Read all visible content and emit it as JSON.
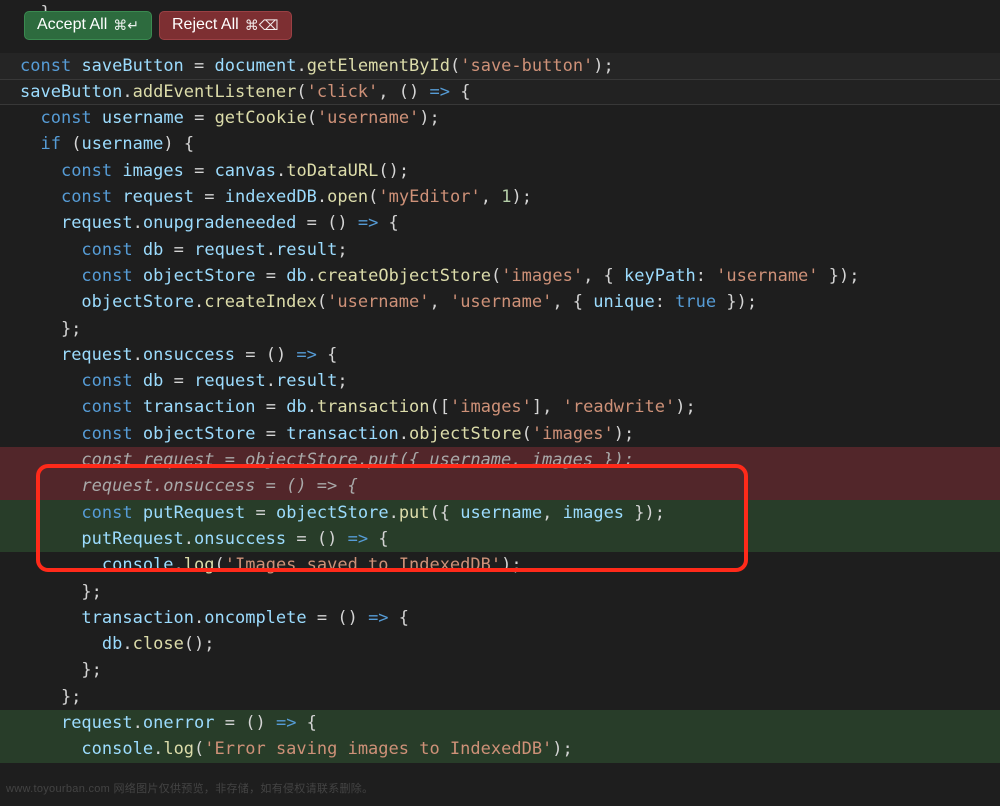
{
  "toolbar": {
    "accept_label": "Accept All",
    "accept_shortcut": "⌘↵",
    "reject_label": "Reject All",
    "reject_shortcut": "⌘⌫"
  },
  "watermark": "www.toyourban.com  网络图片仅供预览，非存储，如有侵权请联系删除。",
  "code": {
    "l1": "  }",
    "l2": "",
    "l3": "const saveButton = document.getElementById('save-button');",
    "l4": "saveButton.addEventListener('click', () => {",
    "l5": "  const username = getCookie('username');",
    "l6": "  if (username) {",
    "l7": "    const images = canvas.toDataURL();",
    "l8": "    const request = indexedDB.open('myEditor', 1);",
    "l9": "    request.onupgradeneeded = () => {",
    "l10": "      const db = request.result;",
    "l11": "      const objectStore = db.createObjectStore('images', { keyPath: 'username' });",
    "l12": "      objectStore.createIndex('username', 'username', { unique: true });",
    "l13": "    };",
    "l14": "    request.onsuccess = () => {",
    "l15": "      const db = request.result;",
    "l16": "      const transaction = db.transaction(['images'], 'readwrite');",
    "l17": "      const objectStore = transaction.objectStore('images');",
    "l18": "      const request = objectStore.put({ username, images });",
    "l19": "      request.onsuccess = () => {",
    "l20": "      const putRequest = objectStore.put({ username, images });",
    "l21": "      putRequest.onsuccess = () => {",
    "l22": "        console.log('Images saved to IndexedDB');",
    "l23": "      };",
    "l24": "      transaction.oncomplete = () => {",
    "l25": "        db.close();",
    "l26": "      };",
    "l27": "    };",
    "l28": "    request.onerror = () => {",
    "l29": "      console.log('Error saving images to IndexedDB');"
  }
}
